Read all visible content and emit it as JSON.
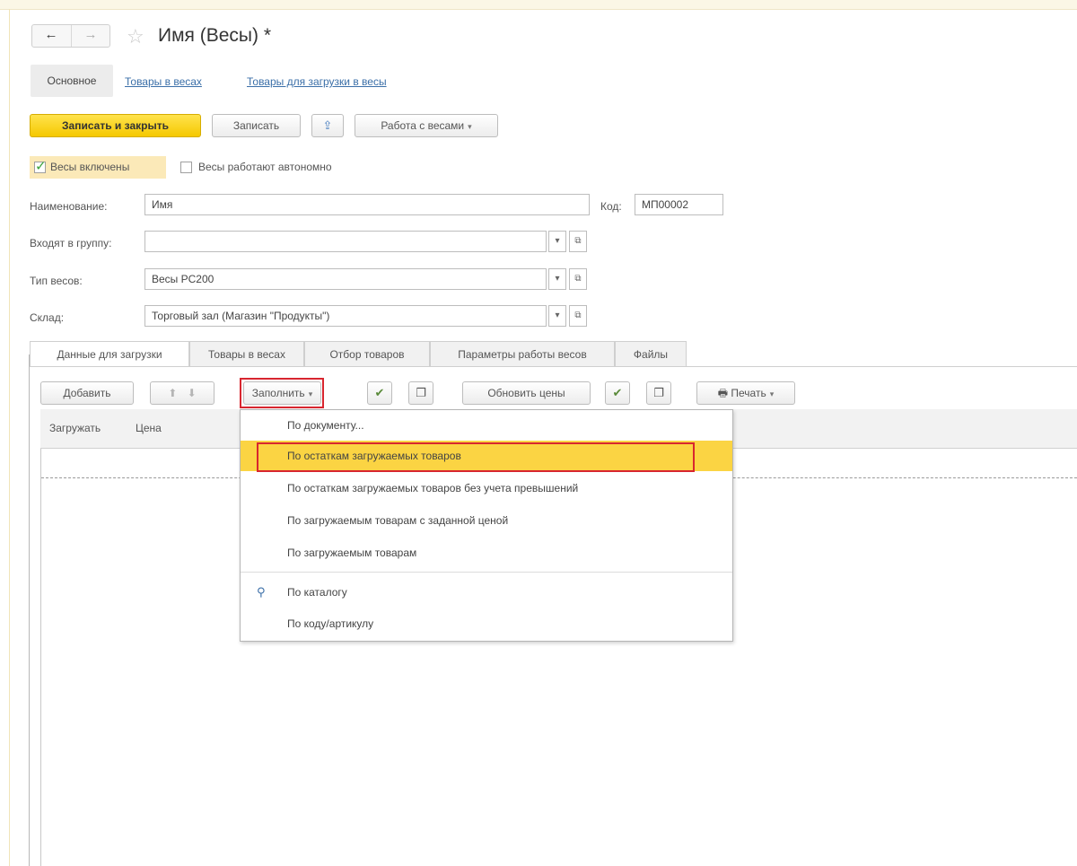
{
  "window": {
    "title": "Имя (Весы) *"
  },
  "nav": {
    "back": "←",
    "forward": "→",
    "star": "☆"
  },
  "section_tabs": [
    {
      "label": "Основное"
    },
    {
      "label": "Товары в весах"
    },
    {
      "label": "Товары для загрузки в весы"
    }
  ],
  "toolbar": {
    "save_close": "Записать и закрыть",
    "save": "Записать",
    "scales_work": "Работа с весами",
    "caret": "▾"
  },
  "checkboxes": {
    "enabled": {
      "label": "Весы включены",
      "checked": true
    },
    "autonomous": {
      "label": "Весы работают автономно",
      "checked": false
    }
  },
  "form": {
    "name": {
      "label": "Наименование:",
      "value": "Имя"
    },
    "code": {
      "label": "Код:",
      "value": "МП00002"
    },
    "group": {
      "label": "Входят в группу:",
      "value": ""
    },
    "scale_type": {
      "label": "Тип весов:",
      "value": "Весы PC200"
    },
    "warehouse": {
      "label": "Склад:",
      "value": "Торговый зал (Магазин \"Продукты\")"
    },
    "dropdown_glyph": "▾",
    "open_glyph": "⧉"
  },
  "data_tabs": [
    {
      "label": "Данные для загрузки"
    },
    {
      "label": "Товары в весах"
    },
    {
      "label": "Отбор товаров"
    },
    {
      "label": "Параметры работы весов"
    },
    {
      "label": "Файлы"
    }
  ],
  "table_toolbar": {
    "add": "Добавить",
    "up": "⬆",
    "down": "⬇",
    "fill": "Заполнить",
    "update_prices": "Обновить цены",
    "print": "Печать",
    "print_icon": "🖶",
    "check_icon": "✔",
    "copy_icon": "❐"
  },
  "table": {
    "columns": [
      "Загружать",
      "Цена"
    ]
  },
  "fill_menu": {
    "items": [
      {
        "label": "По документу..."
      },
      {
        "label": "По остаткам загружаемых товаров",
        "highlighted": true
      },
      {
        "label": "По остаткам загружаемых товаров без учета превышений"
      },
      {
        "label": "По загружаемым товарам с заданной ценой"
      },
      {
        "label": "По загружаемым товарам"
      },
      {
        "label": "По каталогу",
        "icon": "search-icon"
      },
      {
        "label": "По коду/артикулу"
      }
    ]
  },
  "colors": {
    "accent_yellow": "#f5c800",
    "highlight": "#fbd443",
    "link": "#3b6fa8",
    "annotation_red": "#d8262f"
  }
}
